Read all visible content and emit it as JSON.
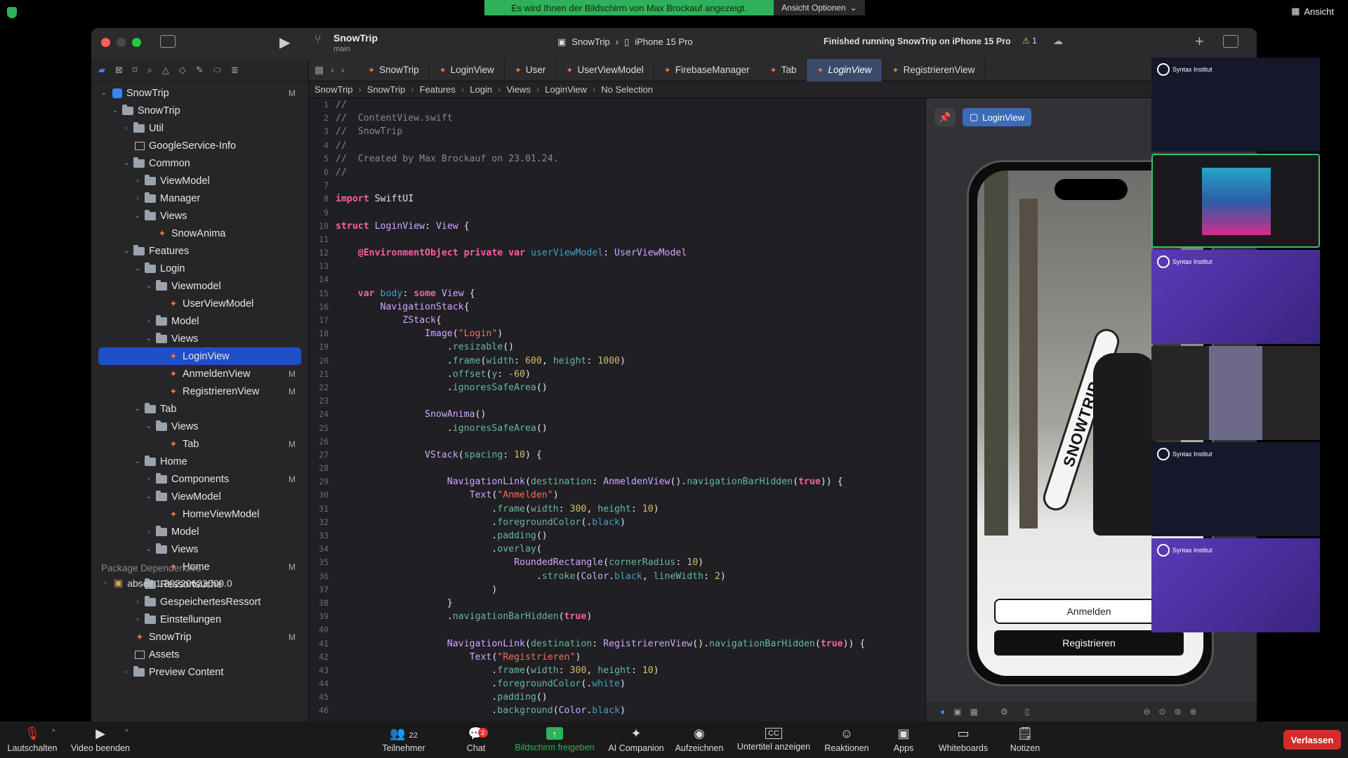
{
  "zoom": {
    "share_banner": "Es wird Ihnen der Bildschirm von Max Brockauf angezeigt.",
    "view_options": "Ansicht Optionen",
    "view_label": "Ansicht",
    "toolbar": {
      "mute": "Lautschalten",
      "video": "Video beenden",
      "participants": "Teilnehmer",
      "participants_count": "22",
      "chat": "Chat",
      "chat_badge": "2",
      "share": "Bildschirm freigeben",
      "ai": "AI Companion",
      "record": "Aufzeichnen",
      "captions": "Untertitel anzeigen",
      "captions_icon": "CC",
      "reactions": "Reaktionen",
      "apps": "Apps",
      "whiteboards": "Whiteboards",
      "notes": "Notizen",
      "leave": "Verlassen"
    },
    "participant_brand": "Syntax Institut"
  },
  "xcode": {
    "project": "SnowTrip",
    "branch": "main",
    "scheme": "SnowTrip",
    "device": "iPhone 15 Pro",
    "status": "Finished running SnowTrip on iPhone 15 Pro",
    "warnings": "1",
    "navigator": {
      "root": "SnowTrip",
      "root_badge": "M",
      "items": [
        {
          "label": "SnowTrip",
          "depth": 1,
          "kind": "folder",
          "open": true,
          "badge": ""
        },
        {
          "label": "Util",
          "depth": 2,
          "kind": "folder",
          "open": false,
          "badge": ""
        },
        {
          "label": "GoogleService-Info",
          "depth": 2,
          "kind": "plist",
          "open": null,
          "badge": ""
        },
        {
          "label": "Common",
          "depth": 2,
          "kind": "folder",
          "open": true,
          "badge": ""
        },
        {
          "label": "ViewModel",
          "depth": 3,
          "kind": "folder",
          "open": false,
          "badge": ""
        },
        {
          "label": "Manager",
          "depth": 3,
          "kind": "folder",
          "open": false,
          "badge": ""
        },
        {
          "label": "Views",
          "depth": 3,
          "kind": "folder",
          "open": true,
          "badge": ""
        },
        {
          "label": "SnowAnima",
          "depth": 4,
          "kind": "swift",
          "open": null,
          "badge": ""
        },
        {
          "label": "Features",
          "depth": 2,
          "kind": "folder",
          "open": true,
          "badge": ""
        },
        {
          "label": "Login",
          "depth": 3,
          "kind": "folder",
          "open": true,
          "badge": ""
        },
        {
          "label": "Viewmodel",
          "depth": 4,
          "kind": "folder",
          "open": true,
          "badge": ""
        },
        {
          "label": "UserViewModel",
          "depth": 5,
          "kind": "swift",
          "open": null,
          "badge": ""
        },
        {
          "label": "Model",
          "depth": 4,
          "kind": "folder",
          "open": false,
          "badge": ""
        },
        {
          "label": "Views",
          "depth": 4,
          "kind": "folder",
          "open": true,
          "badge": ""
        },
        {
          "label": "LoginView",
          "depth": 5,
          "kind": "swift",
          "open": null,
          "badge": "",
          "selected": true
        },
        {
          "label": "AnmeldenView",
          "depth": 5,
          "kind": "swift",
          "open": null,
          "badge": "M"
        },
        {
          "label": "RegistrierenView",
          "depth": 5,
          "kind": "swift",
          "open": null,
          "badge": "M"
        },
        {
          "label": "Tab",
          "depth": 3,
          "kind": "folder",
          "open": true,
          "badge": ""
        },
        {
          "label": "Views",
          "depth": 4,
          "kind": "folder",
          "open": true,
          "badge": ""
        },
        {
          "label": "Tab",
          "depth": 5,
          "kind": "swift",
          "open": null,
          "badge": "M"
        },
        {
          "label": "Home",
          "depth": 3,
          "kind": "folder",
          "open": true,
          "badge": ""
        },
        {
          "label": "Components",
          "depth": 4,
          "kind": "folder",
          "open": false,
          "badge": "M"
        },
        {
          "label": "ViewModel",
          "depth": 4,
          "kind": "folder",
          "open": true,
          "badge": ""
        },
        {
          "label": "HomeViewModel",
          "depth": 5,
          "kind": "swift",
          "open": null,
          "badge": ""
        },
        {
          "label": "Model",
          "depth": 4,
          "kind": "folder",
          "open": false,
          "badge": ""
        },
        {
          "label": "Views",
          "depth": 4,
          "kind": "folder",
          "open": true,
          "badge": ""
        },
        {
          "label": "Home",
          "depth": 5,
          "kind": "swift",
          "open": null,
          "badge": "M"
        },
        {
          "label": "Ressortsuche",
          "depth": 3,
          "kind": "folder",
          "open": false,
          "badge": ""
        },
        {
          "label": "GespeichertesRessort",
          "depth": 3,
          "kind": "folder",
          "open": false,
          "badge": ""
        },
        {
          "label": "Einstellungen",
          "depth": 3,
          "kind": "folder",
          "open": false,
          "badge": ""
        },
        {
          "label": "SnowTrip",
          "depth": 2,
          "kind": "swift",
          "open": null,
          "badge": "M"
        },
        {
          "label": "Assets",
          "depth": 2,
          "kind": "plist",
          "open": null,
          "badge": ""
        },
        {
          "label": "Preview Content",
          "depth": 2,
          "kind": "folder",
          "open": false,
          "badge": ""
        }
      ],
      "package_header": "Package Dependencies",
      "package_item": "abseil 1.20220623000.0"
    },
    "tabs": [
      "SnowTrip",
      "LoginView",
      "User",
      "UserViewModel",
      "FirebaseManager",
      "Tab",
      "LoginView",
      "RegistrierenView"
    ],
    "active_tab_index": 6,
    "breadcrumb": [
      "SnowTrip",
      "SnowTrip",
      "Features",
      "Login",
      "Views",
      "LoginView",
      "No Selection"
    ],
    "preview_chip": "LoginView",
    "preview_buttons": {
      "login": "Anmelden",
      "register": "Registrieren"
    },
    "board_text": "SNOWTRIP",
    "code": [
      [
        [
          "cm",
          "//"
        ]
      ],
      [
        [
          "cm",
          "//  ContentView.swift"
        ]
      ],
      [
        [
          "cm",
          "//  SnowTrip"
        ]
      ],
      [
        [
          "cm",
          "//"
        ]
      ],
      [
        [
          "cm",
          "//  Created by Max Brockauf on 23.01.24."
        ]
      ],
      [
        [
          "cm",
          "//"
        ]
      ],
      [],
      [
        [
          "kw",
          "import"
        ],
        [
          "plain",
          " SwiftUI"
        ]
      ],
      [],
      [
        [
          "kw",
          "struct"
        ],
        [
          "plain",
          " "
        ],
        [
          "ty",
          "LoginView"
        ],
        [
          "plain",
          ": "
        ],
        [
          "ty",
          "View"
        ],
        [
          "plain",
          " {"
        ]
      ],
      [],
      [
        [
          "plain",
          "    "
        ],
        [
          "kw",
          "@EnvironmentObject"
        ],
        [
          "plain",
          " "
        ],
        [
          "kw",
          "private var"
        ],
        [
          "plain",
          " "
        ],
        [
          "prop",
          "userViewModel"
        ],
        [
          "plain",
          ": "
        ],
        [
          "ty",
          "UserViewModel"
        ]
      ],
      [],
      [],
      [
        [
          "plain",
          "    "
        ],
        [
          "kw",
          "var"
        ],
        [
          "plain",
          " "
        ],
        [
          "prop",
          "body"
        ],
        [
          "plain",
          ": "
        ],
        [
          "kw",
          "some"
        ],
        [
          "plain",
          " "
        ],
        [
          "ty",
          "View"
        ],
        [
          "plain",
          " {"
        ]
      ],
      [
        [
          "plain",
          "        "
        ],
        [
          "ty",
          "NavigationStack"
        ],
        [
          "plain",
          "{"
        ]
      ],
      [
        [
          "plain",
          "            "
        ],
        [
          "ty",
          "ZStack"
        ],
        [
          "plain",
          "{"
        ]
      ],
      [
        [
          "plain",
          "                "
        ],
        [
          "ty",
          "Image"
        ],
        [
          "plain",
          "("
        ],
        [
          "str",
          "\"Login\""
        ],
        [
          "plain",
          ")"
        ]
      ],
      [
        [
          "plain",
          "                    ."
        ],
        [
          "fn",
          "resizable"
        ],
        [
          "plain",
          "()"
        ]
      ],
      [
        [
          "plain",
          "                    ."
        ],
        [
          "fn",
          "frame"
        ],
        [
          "plain",
          "("
        ],
        [
          "fn",
          "width"
        ],
        [
          "plain",
          ": "
        ],
        [
          "num",
          "600"
        ],
        [
          "plain",
          ", "
        ],
        [
          "fn",
          "height"
        ],
        [
          "plain",
          ": "
        ],
        [
          "num",
          "1000"
        ],
        [
          "plain",
          ")"
        ]
      ],
      [
        [
          "plain",
          "                    ."
        ],
        [
          "fn",
          "offset"
        ],
        [
          "plain",
          "("
        ],
        [
          "fn",
          "y"
        ],
        [
          "plain",
          ": "
        ],
        [
          "num",
          "-60"
        ],
        [
          "plain",
          ")"
        ]
      ],
      [
        [
          "plain",
          "                    ."
        ],
        [
          "fn",
          "ignoresSafeArea"
        ],
        [
          "plain",
          "()"
        ]
      ],
      [],
      [
        [
          "plain",
          "                "
        ],
        [
          "ty",
          "SnowAnima"
        ],
        [
          "plain",
          "()"
        ]
      ],
      [
        [
          "plain",
          "                    ."
        ],
        [
          "fn",
          "ignoresSafeArea"
        ],
        [
          "plain",
          "()"
        ]
      ],
      [],
      [
        [
          "plain",
          "                "
        ],
        [
          "ty",
          "VStack"
        ],
        [
          "plain",
          "("
        ],
        [
          "fn",
          "spacing"
        ],
        [
          "plain",
          ": "
        ],
        [
          "num",
          "10"
        ],
        [
          "plain",
          ") {"
        ]
      ],
      [],
      [
        [
          "plain",
          "                    "
        ],
        [
          "ty",
          "NavigationLink"
        ],
        [
          "plain",
          "("
        ],
        [
          "fn",
          "destination"
        ],
        [
          "plain",
          ": "
        ],
        [
          "ty",
          "AnmeldenView"
        ],
        [
          "plain",
          "()."
        ],
        [
          "fn",
          "navigationBarHidden"
        ],
        [
          "plain",
          "("
        ],
        [
          "kw",
          "true"
        ],
        [
          "plain",
          ")) {"
        ]
      ],
      [
        [
          "plain",
          "                        "
        ],
        [
          "ty",
          "Text"
        ],
        [
          "plain",
          "("
        ],
        [
          "str",
          "\"Anmelden\""
        ],
        [
          "plain",
          ")"
        ]
      ],
      [
        [
          "plain",
          "                            ."
        ],
        [
          "fn",
          "frame"
        ],
        [
          "plain",
          "("
        ],
        [
          "fn",
          "width"
        ],
        [
          "plain",
          ": "
        ],
        [
          "num",
          "300"
        ],
        [
          "plain",
          ", "
        ],
        [
          "fn",
          "height"
        ],
        [
          "plain",
          ": "
        ],
        [
          "num",
          "10"
        ],
        [
          "plain",
          ")"
        ]
      ],
      [
        [
          "plain",
          "                            ."
        ],
        [
          "fn",
          "foregroundColor"
        ],
        [
          "plain",
          "(."
        ],
        [
          "prop",
          "black"
        ],
        [
          "plain",
          ")"
        ]
      ],
      [
        [
          "plain",
          "                            ."
        ],
        [
          "fn",
          "padding"
        ],
        [
          "plain",
          "()"
        ]
      ],
      [
        [
          "plain",
          "                            ."
        ],
        [
          "fn",
          "overlay"
        ],
        [
          "plain",
          "("
        ]
      ],
      [
        [
          "plain",
          "                                "
        ],
        [
          "ty",
          "RoundedRectangle"
        ],
        [
          "plain",
          "("
        ],
        [
          "fn",
          "cornerRadius"
        ],
        [
          "plain",
          ": "
        ],
        [
          "num",
          "10"
        ],
        [
          "plain",
          ")"
        ]
      ],
      [
        [
          "plain",
          "                                    ."
        ],
        [
          "fn",
          "stroke"
        ],
        [
          "plain",
          "("
        ],
        [
          "ty",
          "Color"
        ],
        [
          "plain",
          "."
        ],
        [
          "prop",
          "black"
        ],
        [
          "plain",
          ", "
        ],
        [
          "fn",
          "lineWidth"
        ],
        [
          "plain",
          ": "
        ],
        [
          "num",
          "2"
        ],
        [
          "plain",
          ")"
        ]
      ],
      [
        [
          "plain",
          "                            )"
        ]
      ],
      [
        [
          "plain",
          "                    }"
        ]
      ],
      [
        [
          "plain",
          "                    ."
        ],
        [
          "fn",
          "navigationBarHidden"
        ],
        [
          "plain",
          "("
        ],
        [
          "kw",
          "true"
        ],
        [
          "plain",
          ")"
        ]
      ],
      [],
      [
        [
          "plain",
          "                    "
        ],
        [
          "ty",
          "NavigationLink"
        ],
        [
          "plain",
          "("
        ],
        [
          "fn",
          "destination"
        ],
        [
          "plain",
          ": "
        ],
        [
          "ty",
          "RegistrierenView"
        ],
        [
          "plain",
          "()."
        ],
        [
          "fn",
          "navigationBarHidden"
        ],
        [
          "plain",
          "("
        ],
        [
          "kw",
          "true"
        ],
        [
          "plain",
          ")) {"
        ]
      ],
      [
        [
          "plain",
          "                        "
        ],
        [
          "ty",
          "Text"
        ],
        [
          "plain",
          "("
        ],
        [
          "str",
          "\"Registrieren\""
        ],
        [
          "plain",
          ")"
        ]
      ],
      [
        [
          "plain",
          "                            ."
        ],
        [
          "fn",
          "frame"
        ],
        [
          "plain",
          "("
        ],
        [
          "fn",
          "width"
        ],
        [
          "plain",
          ": "
        ],
        [
          "num",
          "300"
        ],
        [
          "plain",
          ", "
        ],
        [
          "fn",
          "height"
        ],
        [
          "plain",
          ": "
        ],
        [
          "num",
          "10"
        ],
        [
          "plain",
          ")"
        ]
      ],
      [
        [
          "plain",
          "                            ."
        ],
        [
          "fn",
          "foregroundColor"
        ],
        [
          "plain",
          "(."
        ],
        [
          "prop",
          "white"
        ],
        [
          "plain",
          ")"
        ]
      ],
      [
        [
          "plain",
          "                            ."
        ],
        [
          "fn",
          "padding"
        ],
        [
          "plain",
          "()"
        ]
      ],
      [
        [
          "plain",
          "                            ."
        ],
        [
          "fn",
          "background"
        ],
        [
          "plain",
          "("
        ],
        [
          "ty",
          "Color"
        ],
        [
          "plain",
          "."
        ],
        [
          "prop",
          "black"
        ],
        [
          "plain",
          ")"
        ]
      ]
    ]
  }
}
